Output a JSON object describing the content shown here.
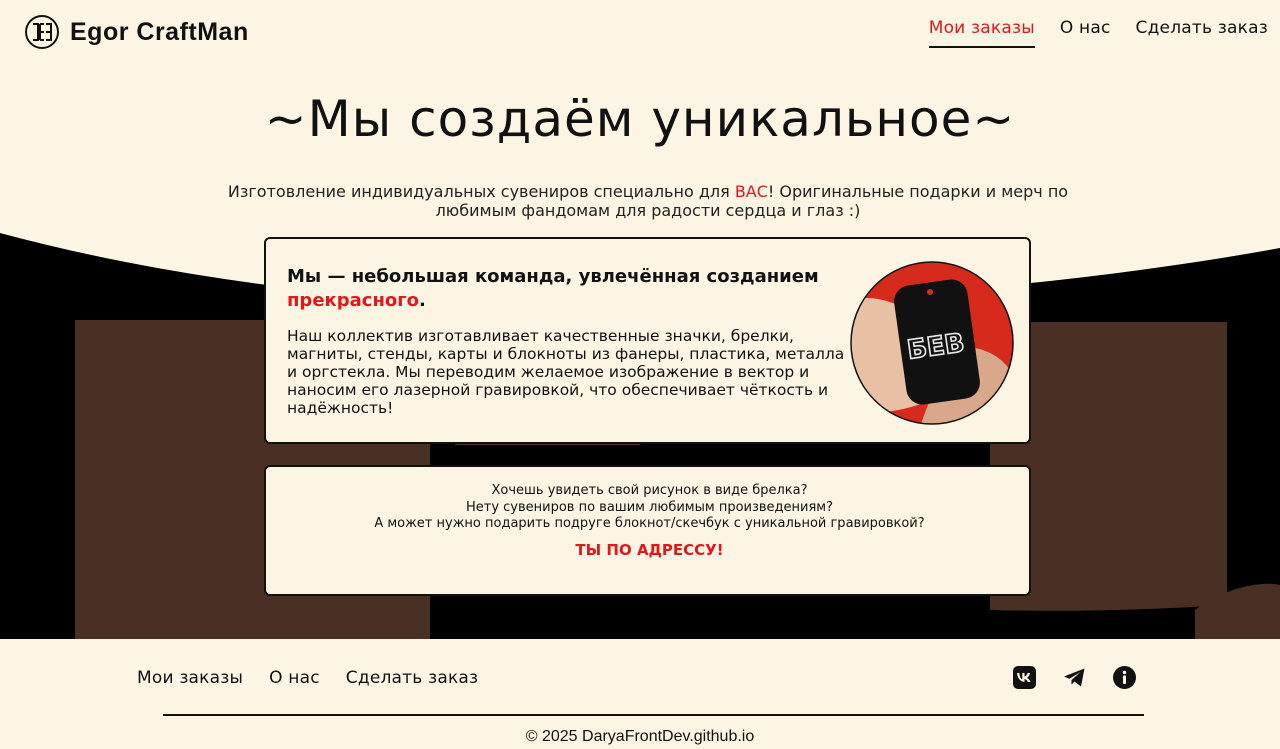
{
  "header": {
    "logo_text": "Egor CraftMan",
    "nav": [
      {
        "label": "Мои заказы",
        "active": true
      },
      {
        "label": "О нас",
        "active": false
      },
      {
        "label": "Сделать заказ",
        "active": false
      }
    ]
  },
  "hero": {
    "title": "~Мы создаём уникальное~",
    "subtitle_before": "Изготовление индивидуальных сувениров специально для ",
    "subtitle_accent": "ВАС",
    "subtitle_after": "! Оригинальные подарки и мерч по любимым фандомам для радости сердца и глаз :)"
  },
  "about": {
    "heading_before": "Мы — небольшая команда, увлечённая созданием ",
    "heading_accent": "прекрасного",
    "heading_after": ".",
    "body": "Наш коллектив изготавливает качественные значки, брелки, магниты, стенды, карты и блокноты из фанеры, пластика, металла и оргстекла. Мы переводим желаемое изображение в вектор и наносим его лазерной гравировкой, что обеспечивает чёткость и надёжность!",
    "photo_tag_text": "БЕВ"
  },
  "cta": {
    "lines": [
      "Хочешь увидеть свой рисунок в виде брелка?",
      "Нету сувениров по вашим любимым произведениям?",
      "А может нужно подарить подруге блокнот/скечбук с уникальной гравировкой?"
    ],
    "action": "ТЫ ПО АДРЕССУ!"
  },
  "footer": {
    "nav": [
      "Мои заказы",
      "О нас",
      "Сделать заказ"
    ],
    "socials": [
      "vk-icon",
      "telegram-icon",
      "info-icon"
    ],
    "copyright": "© 2025 DaryaFrontDev.github.io"
  },
  "colors": {
    "background": "#fdf5e4",
    "accent": "#e0181b",
    "dark": "#000000",
    "brown": "#4a2f25"
  }
}
